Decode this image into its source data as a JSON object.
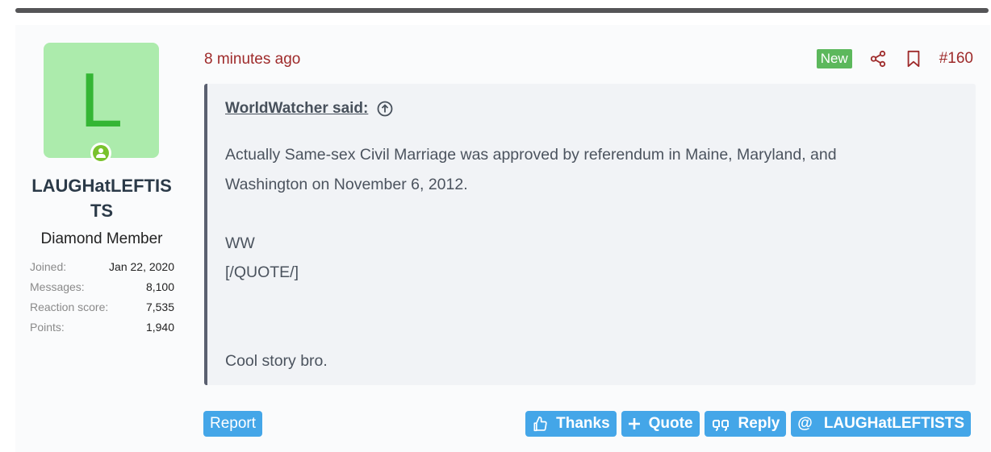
{
  "user": {
    "avatar_letter": "L",
    "name": "LAUGHatLEFTISTS",
    "title": "Diamond Member",
    "stats": [
      {
        "label": "Joined:",
        "value": "Jan 22, 2020"
      },
      {
        "label": "Messages:",
        "value": "8,100"
      },
      {
        "label": "Reaction score:",
        "value": "7,535"
      },
      {
        "label": "Points:",
        "value": "1,940"
      }
    ]
  },
  "post": {
    "timestamp": "8 minutes ago",
    "new_badge": "New",
    "number": "#160",
    "quote": {
      "author": "WorldWatcher said:",
      "lines": [
        "Actually Same-sex Civil Marriage was approved by referendum in Maine, Maryland, and",
        "Washington on November 6, 2012.",
        "",
        "WW",
        "[/QUOTE/]",
        "",
        "",
        "Cool story bro."
      ]
    }
  },
  "actions": {
    "report": "Report",
    "thanks": "Thanks",
    "quote": "Quote",
    "reply": "Reply",
    "mention_symbol": "@",
    "mention": "LAUGHatLEFTISTS"
  },
  "colors": {
    "link_red": "#9e2a2a",
    "button_blue": "#44a6e8",
    "new_green": "#5cb85c",
    "avatar_bg": "#acebac"
  }
}
